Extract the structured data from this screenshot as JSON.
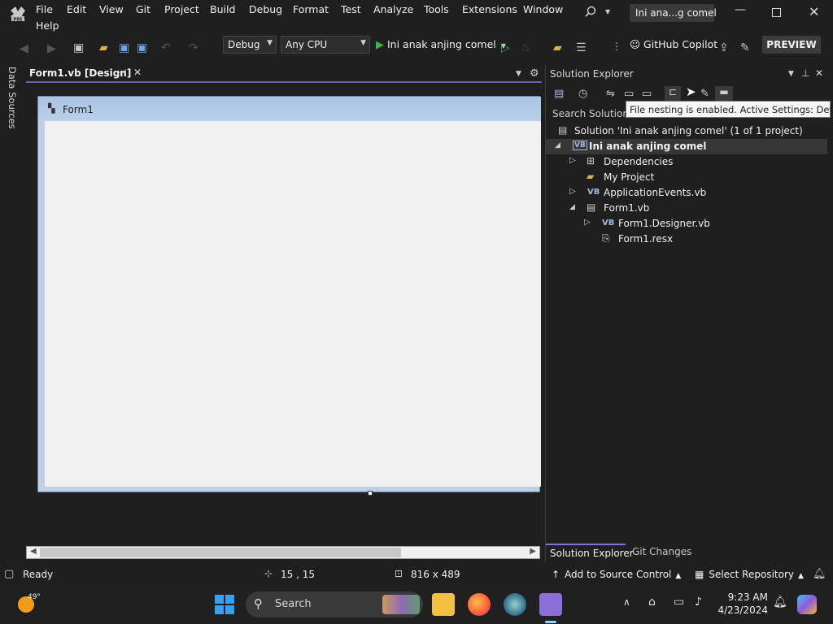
{
  "menubar": {
    "items": [
      "File",
      "Edit",
      "View",
      "Git",
      "Project",
      "Build",
      "Debug",
      "Format",
      "Test",
      "Analyze",
      "Tools",
      "Extensions",
      "Window",
      "Help"
    ],
    "title_badge": "Ini ana...g comel"
  },
  "toolbar": {
    "config": "Debug",
    "platform": "Any CPU",
    "run_target": "Ini anak anjing comel",
    "copilot": "GitHub Copilot",
    "preview": "PREVIEW"
  },
  "left_strip": {
    "label": "Data Sources"
  },
  "document": {
    "tab_label": "Form1.vb [Design]",
    "form_title": "Form1"
  },
  "solution_explorer": {
    "title": "Solution Explorer",
    "search_placeholder": "Search Solution E",
    "tooltip": "File nesting is enabled. Active Settings: Default",
    "solution": "Solution 'Ini anak anjing comel' (1 of 1 project)",
    "project": "Ini anak anjing comel",
    "items": [
      {
        "label": "Dependencies"
      },
      {
        "label": "My Project"
      },
      {
        "label": "ApplicationEvents.vb",
        "badge": "VB"
      },
      {
        "label": "Form1.vb"
      },
      {
        "label": "Form1.Designer.vb",
        "badge": "VB"
      },
      {
        "label": "Form1.resx"
      }
    ],
    "project_badge": "VB",
    "bottom_tabs": [
      "Solution Explorer",
      "Git Changes"
    ]
  },
  "statusbar": {
    "ready": "Ready",
    "position": "15 , 15",
    "size": "816 x 489",
    "source_control": "Add to Source Control",
    "repository": "Select Repository"
  },
  "taskbar": {
    "temperature": "49°",
    "search": "Search",
    "time": "9:23 AM",
    "date": "4/23/2024"
  },
  "colors": {
    "accent": "#8a6fd8",
    "background": "#1f1f1f",
    "form_titlebar": "#b9d0ea",
    "run_green": "#3cb34a"
  }
}
